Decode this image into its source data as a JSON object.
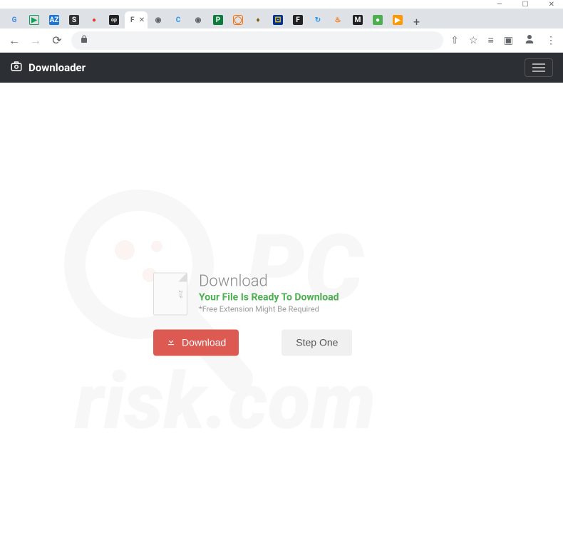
{
  "window": {
    "minimize": "—",
    "maximize": "☐",
    "close": "✕"
  },
  "tabs": [
    {
      "favicon": "G",
      "class": "fi-g"
    },
    {
      "favicon": "▶",
      "class": "fi-play"
    },
    {
      "favicon": "AZ",
      "class": "fi-az"
    },
    {
      "favicon": "S",
      "class": "fi-s"
    },
    {
      "favicon": "●",
      "class": "fi-red"
    },
    {
      "favicon": "op",
      "class": "fi-op"
    },
    {
      "favicon": "F",
      "class": "fi-f",
      "active": true
    },
    {
      "favicon": "◉",
      "class": "fi-globe"
    },
    {
      "favicon": "C",
      "class": "fi-c"
    },
    {
      "favicon": "◉",
      "class": "fi-globe"
    },
    {
      "favicon": "P",
      "class": "fi-p"
    },
    {
      "favicon": "◯",
      "class": "fi-o"
    },
    {
      "favicon": "♦",
      "class": "fi-shield"
    },
    {
      "favicon": "⚀",
      "class": "fi-eu"
    },
    {
      "favicon": "F",
      "class": "fi-fb"
    },
    {
      "favicon": "↻",
      "class": "fi-cycle"
    },
    {
      "favicon": "♨",
      "class": "fi-flame"
    },
    {
      "favicon": "M",
      "class": "fi-m"
    },
    {
      "favicon": "●",
      "class": "fi-cam"
    },
    {
      "favicon": "▶",
      "class": "fi-oplay"
    }
  ],
  "new_tab": "+",
  "nav": {
    "back": "←",
    "forward": "→",
    "reload": "⟳"
  },
  "addr_icons": {
    "share": "⇧",
    "star": "☆",
    "list": "≡",
    "ext": "▣",
    "profile": "👤",
    "menu": "⋮"
  },
  "app": {
    "brand": "Downloader"
  },
  "card": {
    "title": "Download",
    "ready": "Your File Is Ready To Download",
    "note": "*Free Extension Might Be Required",
    "download_btn": "Download",
    "step_btn": "Step One"
  },
  "watermark_text": "PC risk.com"
}
